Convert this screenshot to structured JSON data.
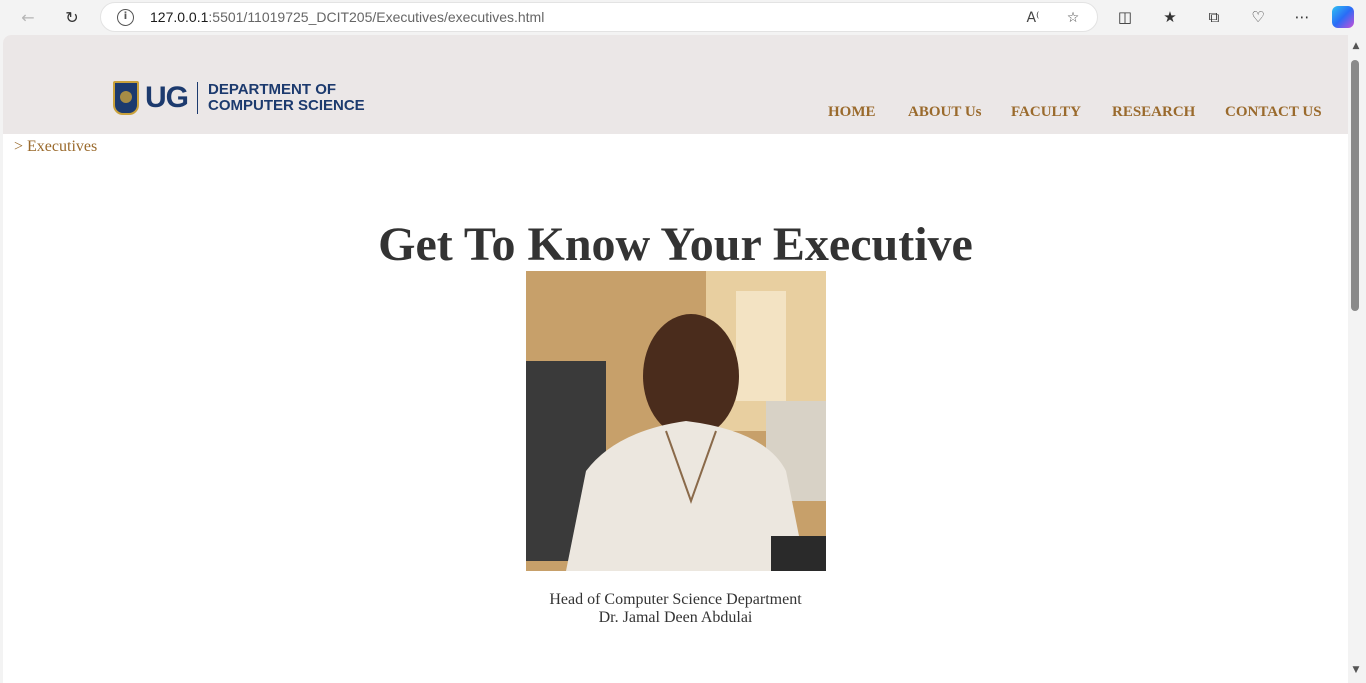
{
  "browser": {
    "url_host": "127.0.0.1",
    "url_rest": ":5501/11019725_DCIT205/Executives/executives.html"
  },
  "header": {
    "logo_ug": "UG",
    "logo_line1": "DEPARTMENT OF",
    "logo_line2": "COMPUTER SCIENCE",
    "nav": [
      "HOME",
      "ABOUT Us",
      "FACULTY",
      "RESEARCH",
      "CONTACT US"
    ]
  },
  "breadcrumb": "> Executives",
  "main": {
    "title": "Get To Know Your Executive",
    "caption_role": "Head of Computer Science Department",
    "caption_name": "Dr. Jamal Deen Abdulai"
  }
}
